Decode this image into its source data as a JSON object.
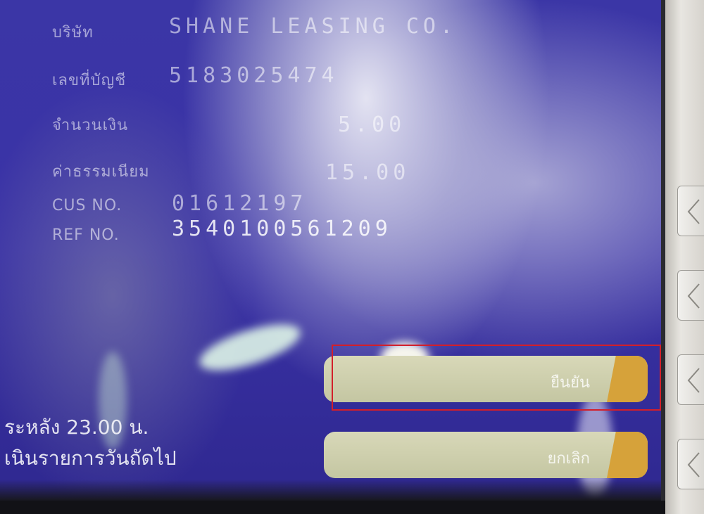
{
  "screen": {
    "fields": [
      {
        "label": "บริษัท",
        "value": "SHANE LEASING CO."
      },
      {
        "label": "เลขที่บัญชี",
        "value": "5183025474"
      },
      {
        "label": "จำนวนเงิน",
        "value": "5.00"
      },
      {
        "label": "ค่าธรรมเนียม",
        "value": "15.00"
      },
      {
        "label": "CUS NO.",
        "value": "01612197"
      },
      {
        "label": "REF NO.",
        "value": "3540100561209"
      }
    ],
    "notice": {
      "line1": "ระหลัง 23.00 น.",
      "line2": "เนินรายการวันถัดไป"
    },
    "buttons": {
      "confirm": "ยืนยัน",
      "cancel": "ยกเลิก"
    }
  },
  "colors": {
    "screen_blue": "#3b36a6",
    "button_face": "#d8d8b8",
    "button_tab": "#d6a23a",
    "highlight": "#d21f2a"
  }
}
